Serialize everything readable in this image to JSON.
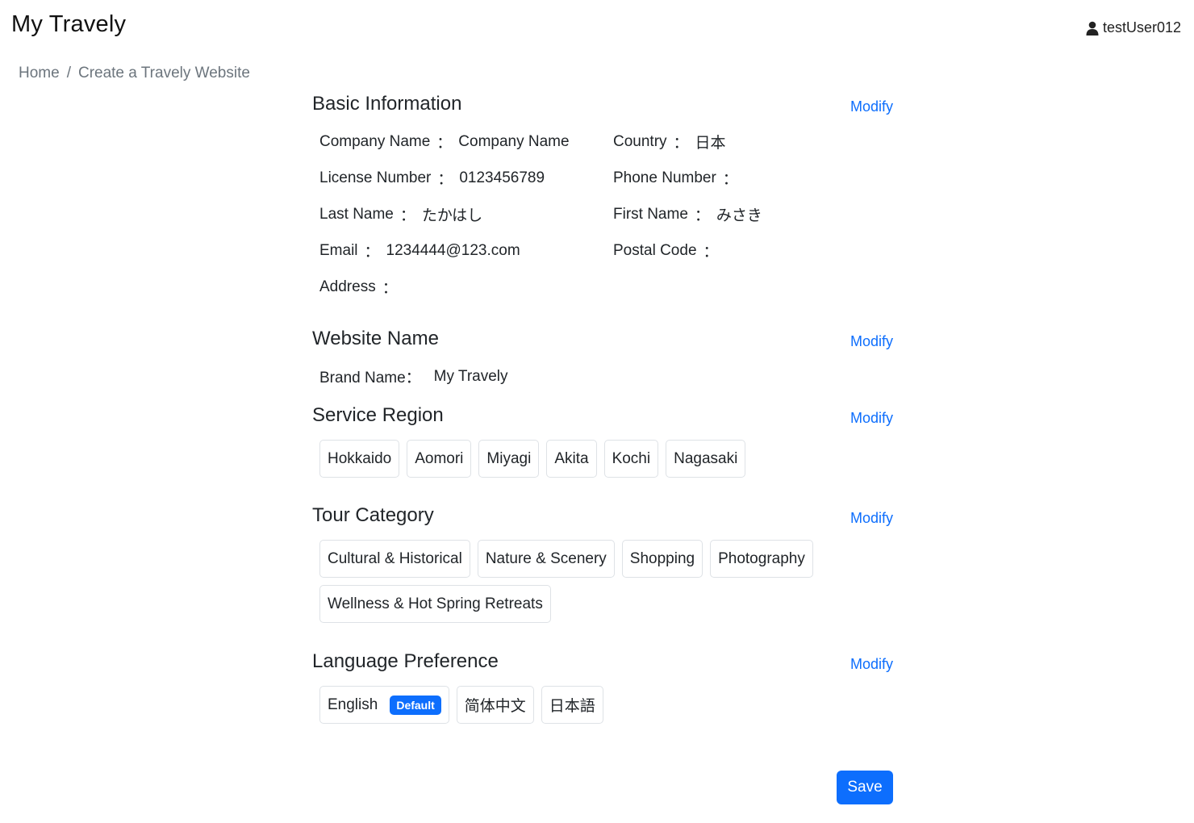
{
  "app": {
    "title": "My Travely"
  },
  "user": {
    "name": "testUser012",
    "icon": "person-icon"
  },
  "breadcrumb": {
    "home": "Home",
    "separator": "/",
    "current": "Create a Travely Website"
  },
  "modify_label": "Modify",
  "basic_info": {
    "title": "Basic Information",
    "fields": {
      "company_name": {
        "label": "Company Name",
        "value": "Company Name"
      },
      "country": {
        "label": "Country",
        "value": "日本"
      },
      "license_number": {
        "label": "License Number",
        "value": "0123456789"
      },
      "phone_number": {
        "label": "Phone Number",
        "value": ""
      },
      "last_name": {
        "label": "Last Name",
        "value": "たかはし"
      },
      "first_name": {
        "label": "First Name",
        "value": "みさき"
      },
      "email": {
        "label": "Email",
        "value": "1234444@123.com"
      },
      "postal_code": {
        "label": "Postal Code",
        "value": ""
      },
      "address": {
        "label": "Address",
        "value": ""
      }
    },
    "colon": "："
  },
  "website_name": {
    "title": "Website Name",
    "brand_label": "Brand Name：",
    "brand_value": "My Travely"
  },
  "service_region": {
    "title": "Service Region",
    "items": [
      "Hokkaido",
      "Aomori",
      "Miyagi",
      "Akita",
      "Kochi",
      "Nagasaki"
    ]
  },
  "tour_category": {
    "title": "Tour Category",
    "items": [
      "Cultural & Historical",
      "Nature & Scenery",
      "Shopping",
      "Photography",
      "Wellness & Hot Spring Retreats"
    ]
  },
  "language_preference": {
    "title": "Language Preference",
    "items": [
      "English",
      "简体中文",
      "日本語"
    ],
    "default_badge": "Default"
  },
  "save_label": "Save",
  "colors": {
    "primary": "#0d6efd",
    "border": "#dee2e6",
    "muted": "#6c757d"
  }
}
